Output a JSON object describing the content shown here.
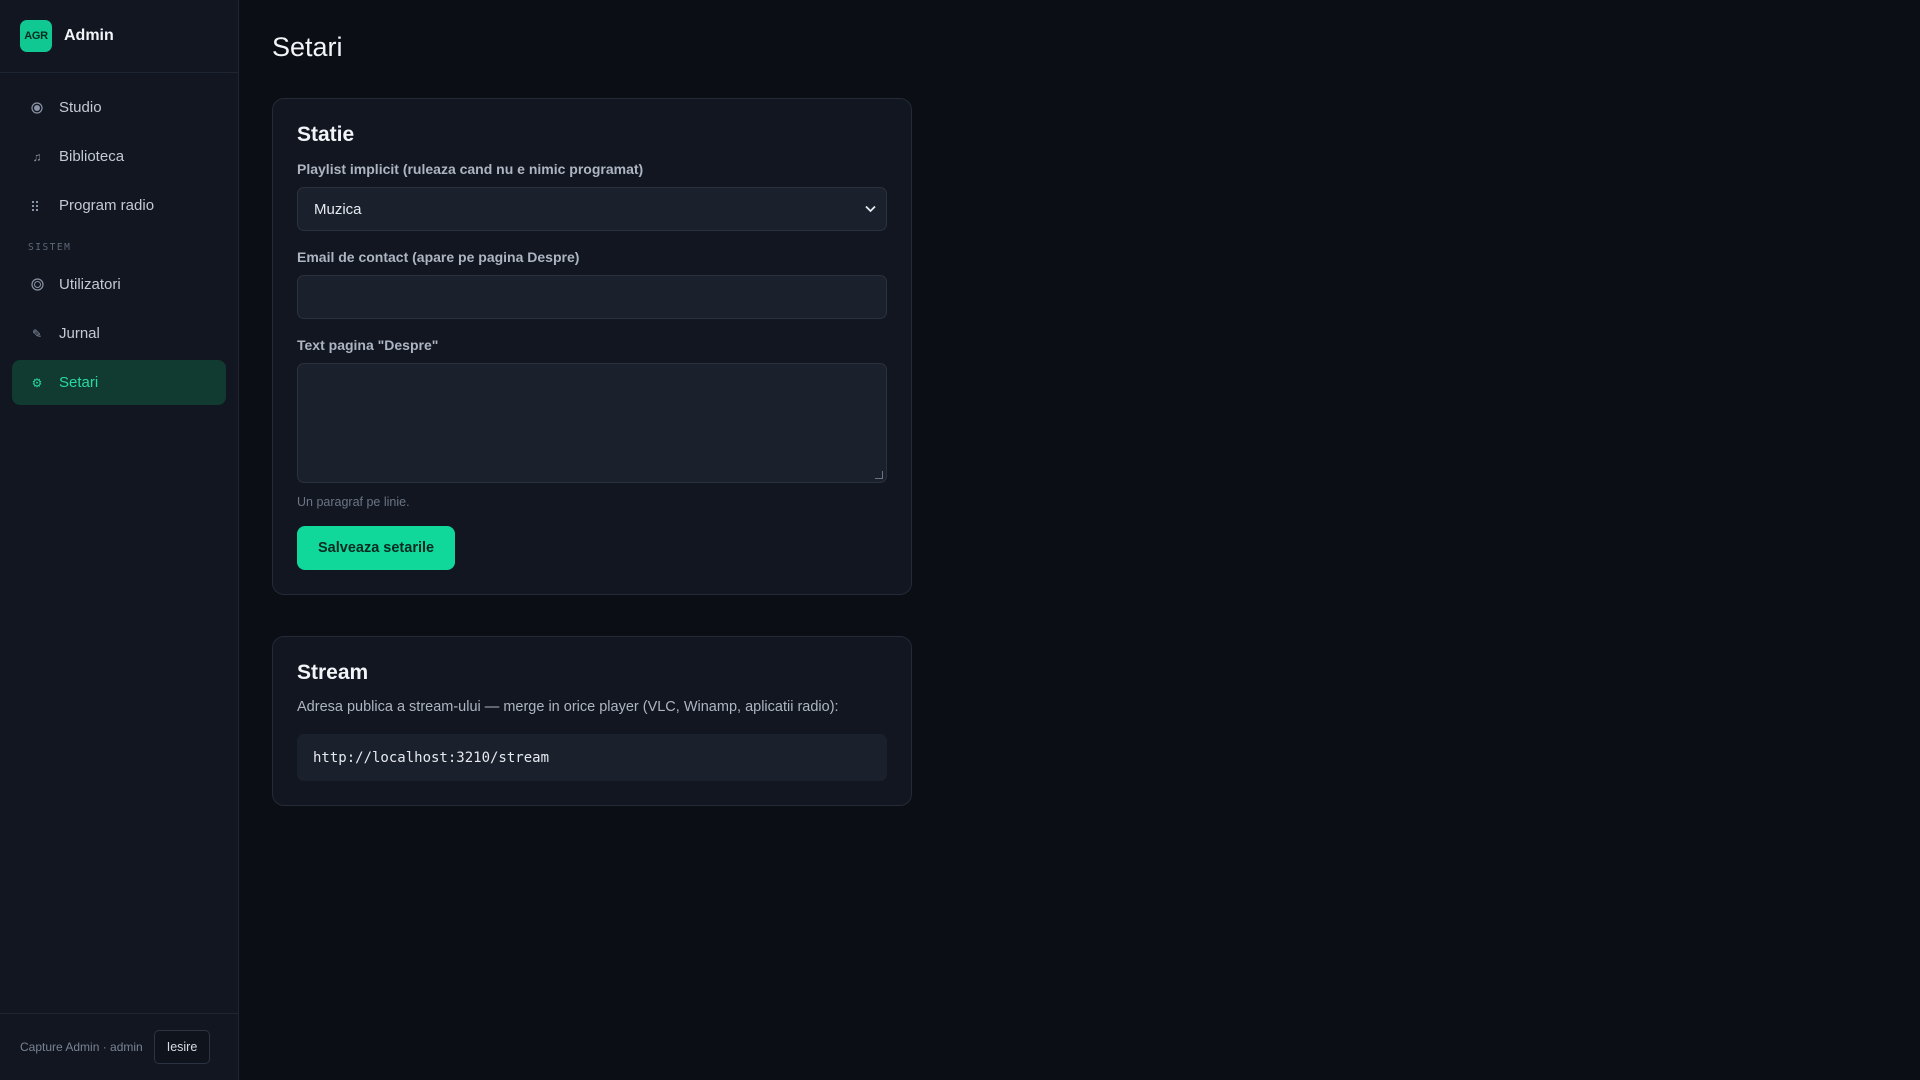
{
  "brand": {
    "logo_text": "AGR",
    "name": "Admin"
  },
  "nav": {
    "items": [
      {
        "label": "Studio",
        "icon": "radio-dot-icon"
      },
      {
        "label": "Biblioteca",
        "icon": "music-note-icon"
      },
      {
        "label": "Program radio",
        "icon": "grid-icon"
      }
    ],
    "section_label": "SISTEM",
    "system_items": [
      {
        "label": "Utilizatori",
        "icon": "user-circle-icon"
      },
      {
        "label": "Jurnal",
        "icon": "pencil-icon"
      },
      {
        "label": "Setari",
        "icon": "gear-icon",
        "active": true
      }
    ]
  },
  "footer": {
    "user_text": "Capture Admin · admin",
    "logout_label": "Iesire"
  },
  "page": {
    "title": "Setari"
  },
  "station": {
    "title": "Statie",
    "playlist_label": "Playlist implicit (ruleaza cand nu e nimic programat)",
    "playlist_value": "Muzica",
    "email_label": "Email de contact (apare pe pagina Despre)",
    "email_value": "",
    "about_label": "Text pagina \"Despre\"",
    "about_value": "",
    "about_hint": "Un paragraf pe linie.",
    "save_label": "Salveaza setarile"
  },
  "stream": {
    "title": "Stream",
    "description": "Adresa publica a stream-ului — merge in orice player (VLC, Winamp, aplicatii radio):",
    "url": "http://localhost:3210/stream"
  },
  "colors": {
    "accent": "#10d89a",
    "active_nav_bg": "#113a31",
    "background": "#0b0e14",
    "panel": "#111620"
  }
}
